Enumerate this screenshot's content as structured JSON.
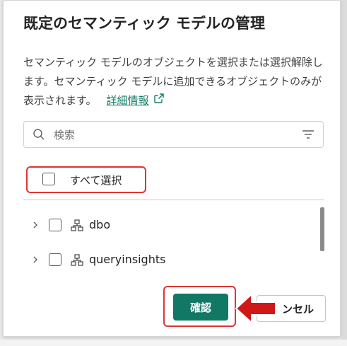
{
  "dialog": {
    "title": "既定のセマンティック モデルの管理",
    "description": "セマンティック モデルのオブジェクトを選択または選択解除します。セマンティック モデルに追加できるオブジェクトのみが表示されます。",
    "learn_more": "詳細情報"
  },
  "search": {
    "placeholder": "検索"
  },
  "select_all": {
    "label": "すべて選択",
    "checked": false
  },
  "tree": {
    "items": [
      {
        "label": "dbo",
        "checked": false,
        "expanded": false
      },
      {
        "label": "queryinsights",
        "checked": false,
        "expanded": false
      }
    ]
  },
  "buttons": {
    "confirm": "確認",
    "cancel": "ンセル"
  },
  "colors": {
    "accent": "#117865",
    "highlight": "#e03434",
    "arrow": "#d01818"
  }
}
